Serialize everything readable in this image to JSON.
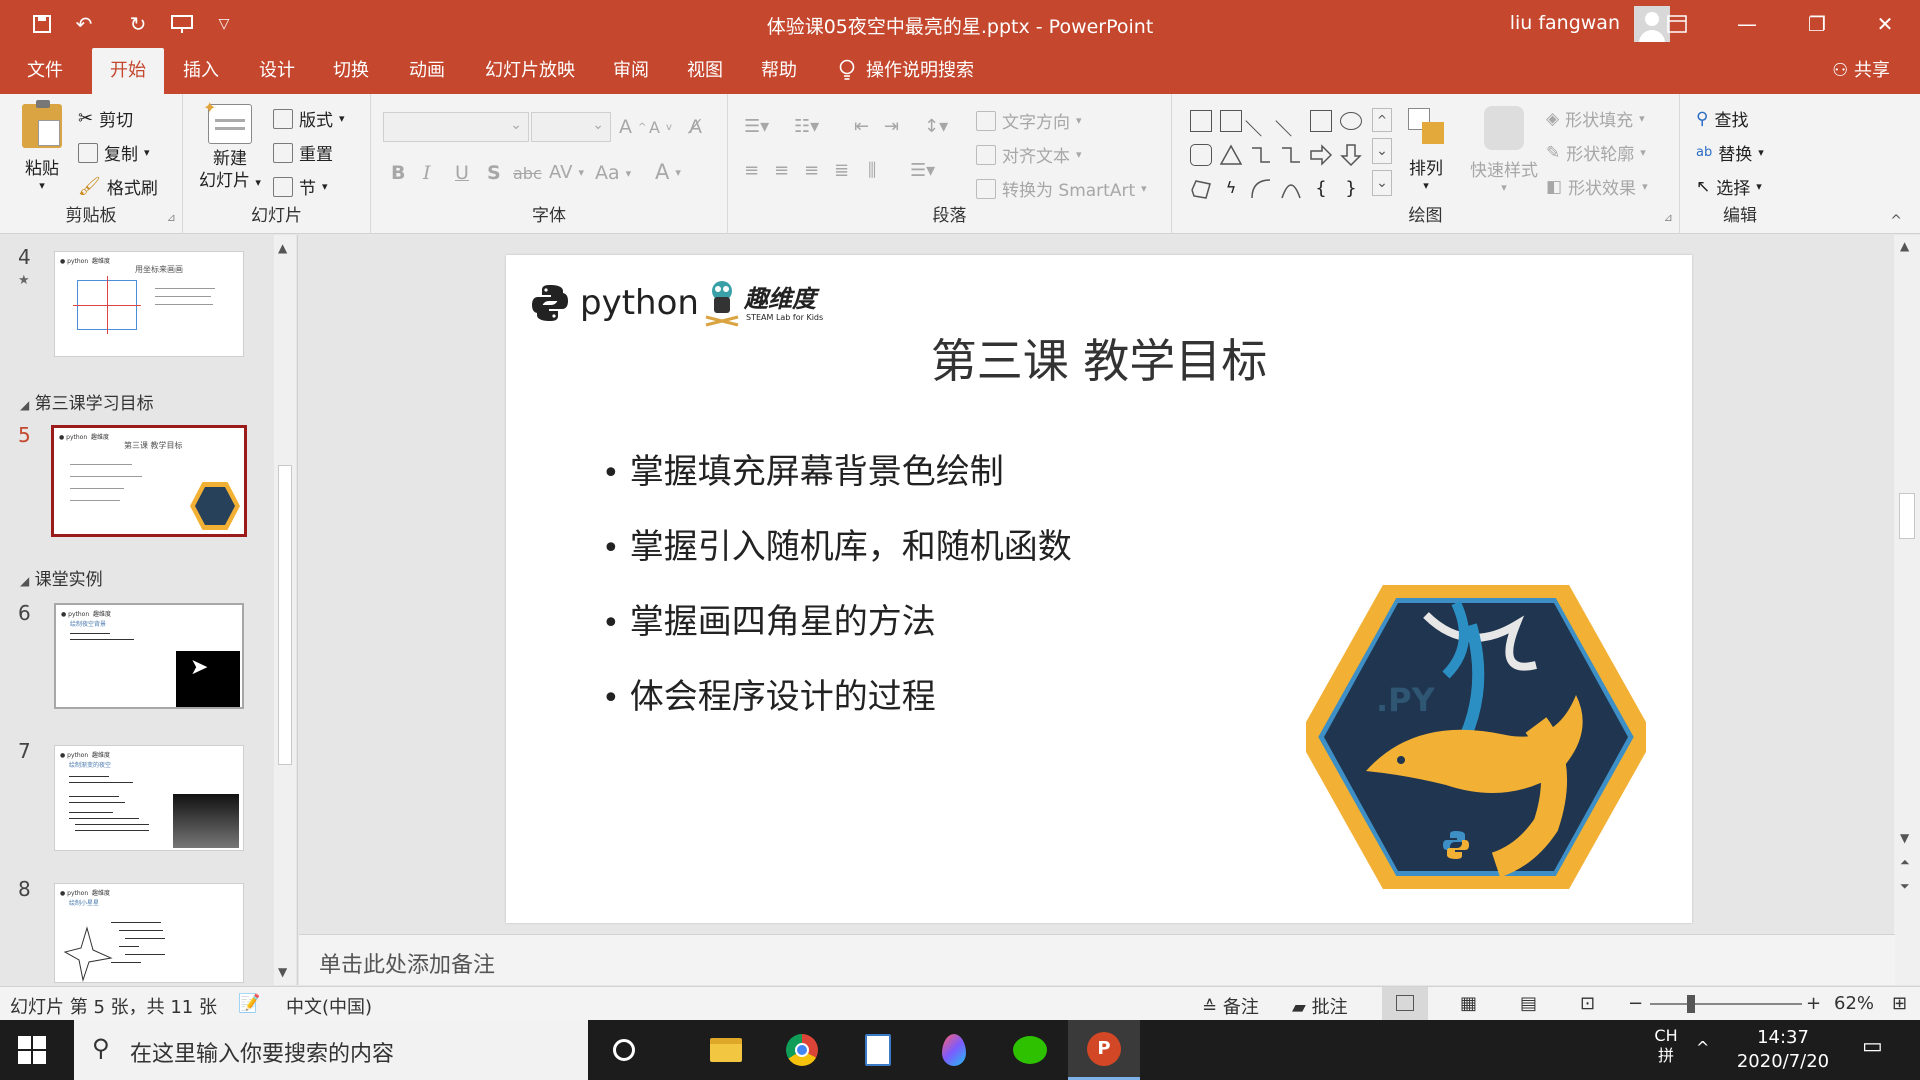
{
  "window": {
    "title": "体验课05夜空中最亮的星.pptx  -  PowerPoint",
    "user": "liu fangwan"
  },
  "tabs": [
    {
      "label": "文件"
    },
    {
      "label": "开始"
    },
    {
      "label": "插入"
    },
    {
      "label": "设计"
    },
    {
      "label": "切换"
    },
    {
      "label": "动画"
    },
    {
      "label": "幻灯片放映"
    },
    {
      "label": "审阅"
    },
    {
      "label": "视图"
    },
    {
      "label": "帮助"
    }
  ],
  "tell_me": "操作说明搜索",
  "share": "共享",
  "ribbon": {
    "clipboard": {
      "label": "剪贴板",
      "paste": "粘贴",
      "cut": "剪切",
      "copy": "复制",
      "format_painter": "格式刷"
    },
    "slides": {
      "label": "幻灯片",
      "new_slide_1": "新建",
      "new_slide_2": "幻灯片",
      "layout": "版式",
      "reset": "重置",
      "section": "节"
    },
    "font": {
      "label": "字体",
      "bold": "B",
      "italic": "I",
      "underline": "U",
      "shadow": "S",
      "strike": "abc",
      "spacing": "AV",
      "case": "Aa",
      "color": "A"
    },
    "paragraph": {
      "label": "段落",
      "text_direction": "文字方向",
      "align_text": "对齐文本",
      "smartart": "转换为 SmartArt"
    },
    "drawing": {
      "label": "绘图",
      "arrange": "排列",
      "quick_styles": "快速样式",
      "shape_fill": "形状填充",
      "shape_outline": "形状轮廓",
      "shape_effects": "形状效果"
    },
    "editing": {
      "label": "编辑",
      "find": "查找",
      "replace": "替换",
      "select": "选择"
    }
  },
  "thumbnails": {
    "sections": [
      {
        "name": "第三课学习目标"
      },
      {
        "name": "课堂实例"
      }
    ],
    "slides": [
      {
        "num": "4",
        "title": "用坐标来画画"
      },
      {
        "num": "5",
        "title": "第三课 教学目标"
      },
      {
        "num": "6",
        "title": "绘制夜空背景"
      },
      {
        "num": "7",
        "title": "绘制渐变的夜空"
      },
      {
        "num": "8",
        "title": "绘制小星星"
      }
    ]
  },
  "slide": {
    "brand_python": "python",
    "brand_qwd": "趣维度",
    "brand_qwd_sub": "STEAM Lab for Kids",
    "title": "第三课 教学目标",
    "bullets": [
      "掌握填充屏幕背景色绘制",
      "掌握引入随机库，和随机函数",
      "掌握画四角星的方法",
      "体会程序设计的过程"
    ],
    "badge_text": ".PY"
  },
  "notes_placeholder": "单击此处添加备注",
  "status": {
    "slide_pos": "幻灯片 第 5 张，共 11 张",
    "language": "中文(中国)",
    "notes": "备注",
    "comments": "批注",
    "zoom": "62%"
  },
  "taskbar": {
    "search_placeholder": "在这里输入你要搜索的内容",
    "ime": "CH",
    "ime2": "拼",
    "time": "14:37",
    "date": "2020/7/20"
  }
}
